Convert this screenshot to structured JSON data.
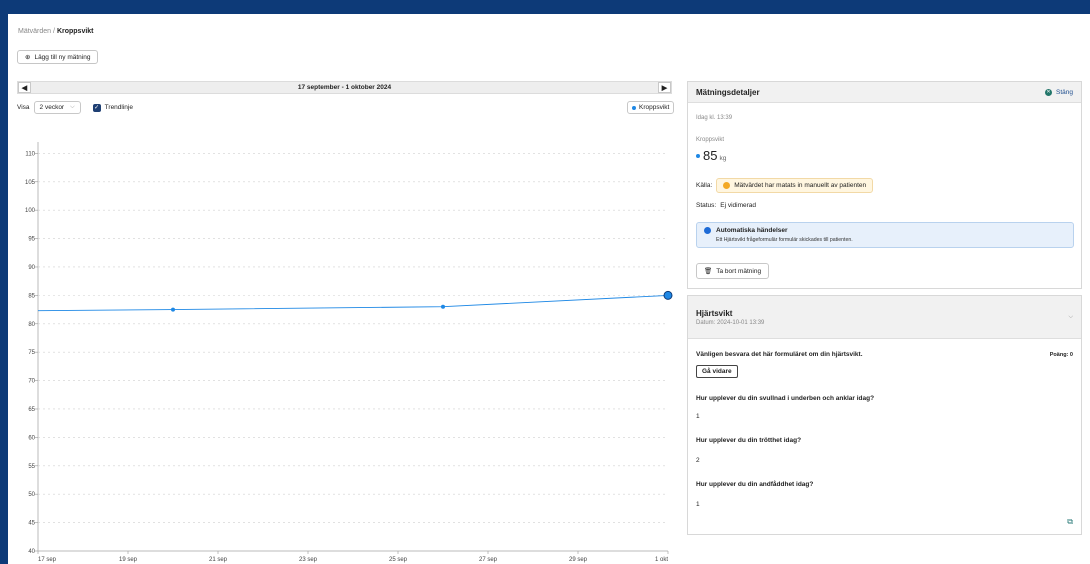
{
  "breadcrumb": {
    "parent": "Mätvärden",
    "separator": "/",
    "current": "Kroppsvikt"
  },
  "add_button": {
    "label": "Lägg till ny mätning",
    "icon": "plus-circle-icon"
  },
  "date_range": {
    "label": "17 september - 1 oktober 2024",
    "prev_icon": "◀",
    "next_icon": "▶"
  },
  "controls": {
    "show_label": "Visa",
    "period_value": "2 veckor",
    "trend_label": "Trendlinje",
    "trend_checked": true,
    "legend_label": "Kroppsvikt"
  },
  "chart_data": {
    "type": "line",
    "x_ticks": [
      "17 sep",
      "19 sep",
      "21 sep",
      "23 sep",
      "25 sep",
      "27 sep",
      "29 sep",
      "1 okt"
    ],
    "xlim": [
      "2024-09-17",
      "2024-10-01"
    ],
    "y_ticks": [
      40,
      45,
      50,
      55,
      60,
      65,
      70,
      75,
      80,
      85,
      90,
      95,
      100,
      105,
      110
    ],
    "ylim": [
      40,
      112
    ],
    "grid": true,
    "legend": "top-right",
    "series": [
      {
        "name": "Kroppsvikt",
        "color": "#1e88e5",
        "points": [
          {
            "x": "2024-09-20",
            "y": 82.5
          },
          {
            "x": "2024-09-26",
            "y": 83.0
          },
          {
            "x": "2024-10-01",
            "y": 85.0
          }
        ]
      }
    ],
    "trendline": {
      "color": "#1e88e5",
      "points": [
        {
          "x": "2024-09-17",
          "y": 82.3
        },
        {
          "x": "2024-09-20",
          "y": 82.5
        },
        {
          "x": "2024-09-26",
          "y": 83.0
        },
        {
          "x": "2024-10-01",
          "y": 85.0
        }
      ]
    }
  },
  "details": {
    "title": "Mätningsdetaljer",
    "close_label": "Stäng",
    "timestamp": "Idag kl. 13:39",
    "metric_label": "Kroppsvikt",
    "value": "85",
    "unit": "kg",
    "source_label": "Källa:",
    "source_value": "Mätvärdet har matats in manuellt av patienten",
    "status_label": "Status:",
    "status_value": "Ej vidimerad",
    "events_title": "Automatiska händelser",
    "events_text": "Ett Hjärtsvikt frågeformulär formulär skickades till patienten.",
    "delete_label": "Ta bort mätning"
  },
  "form": {
    "title": "Hjärtsvikt",
    "date": "Datum: 2024-10-01 13:39",
    "intro": "Vänligen besvara det här formuläret om din hjärtsvikt.",
    "score": "Poäng: 0",
    "continue_label": "Gå vidare",
    "questions": [
      {
        "q": "Hur upplever du din svullnad i underben och anklar idag?",
        "a": "1"
      },
      {
        "q": "Hur upplever du din trötthet idag?",
        "a": "2"
      },
      {
        "q": "Hur upplever du din andfåddhet idag?",
        "a": "1"
      }
    ]
  }
}
